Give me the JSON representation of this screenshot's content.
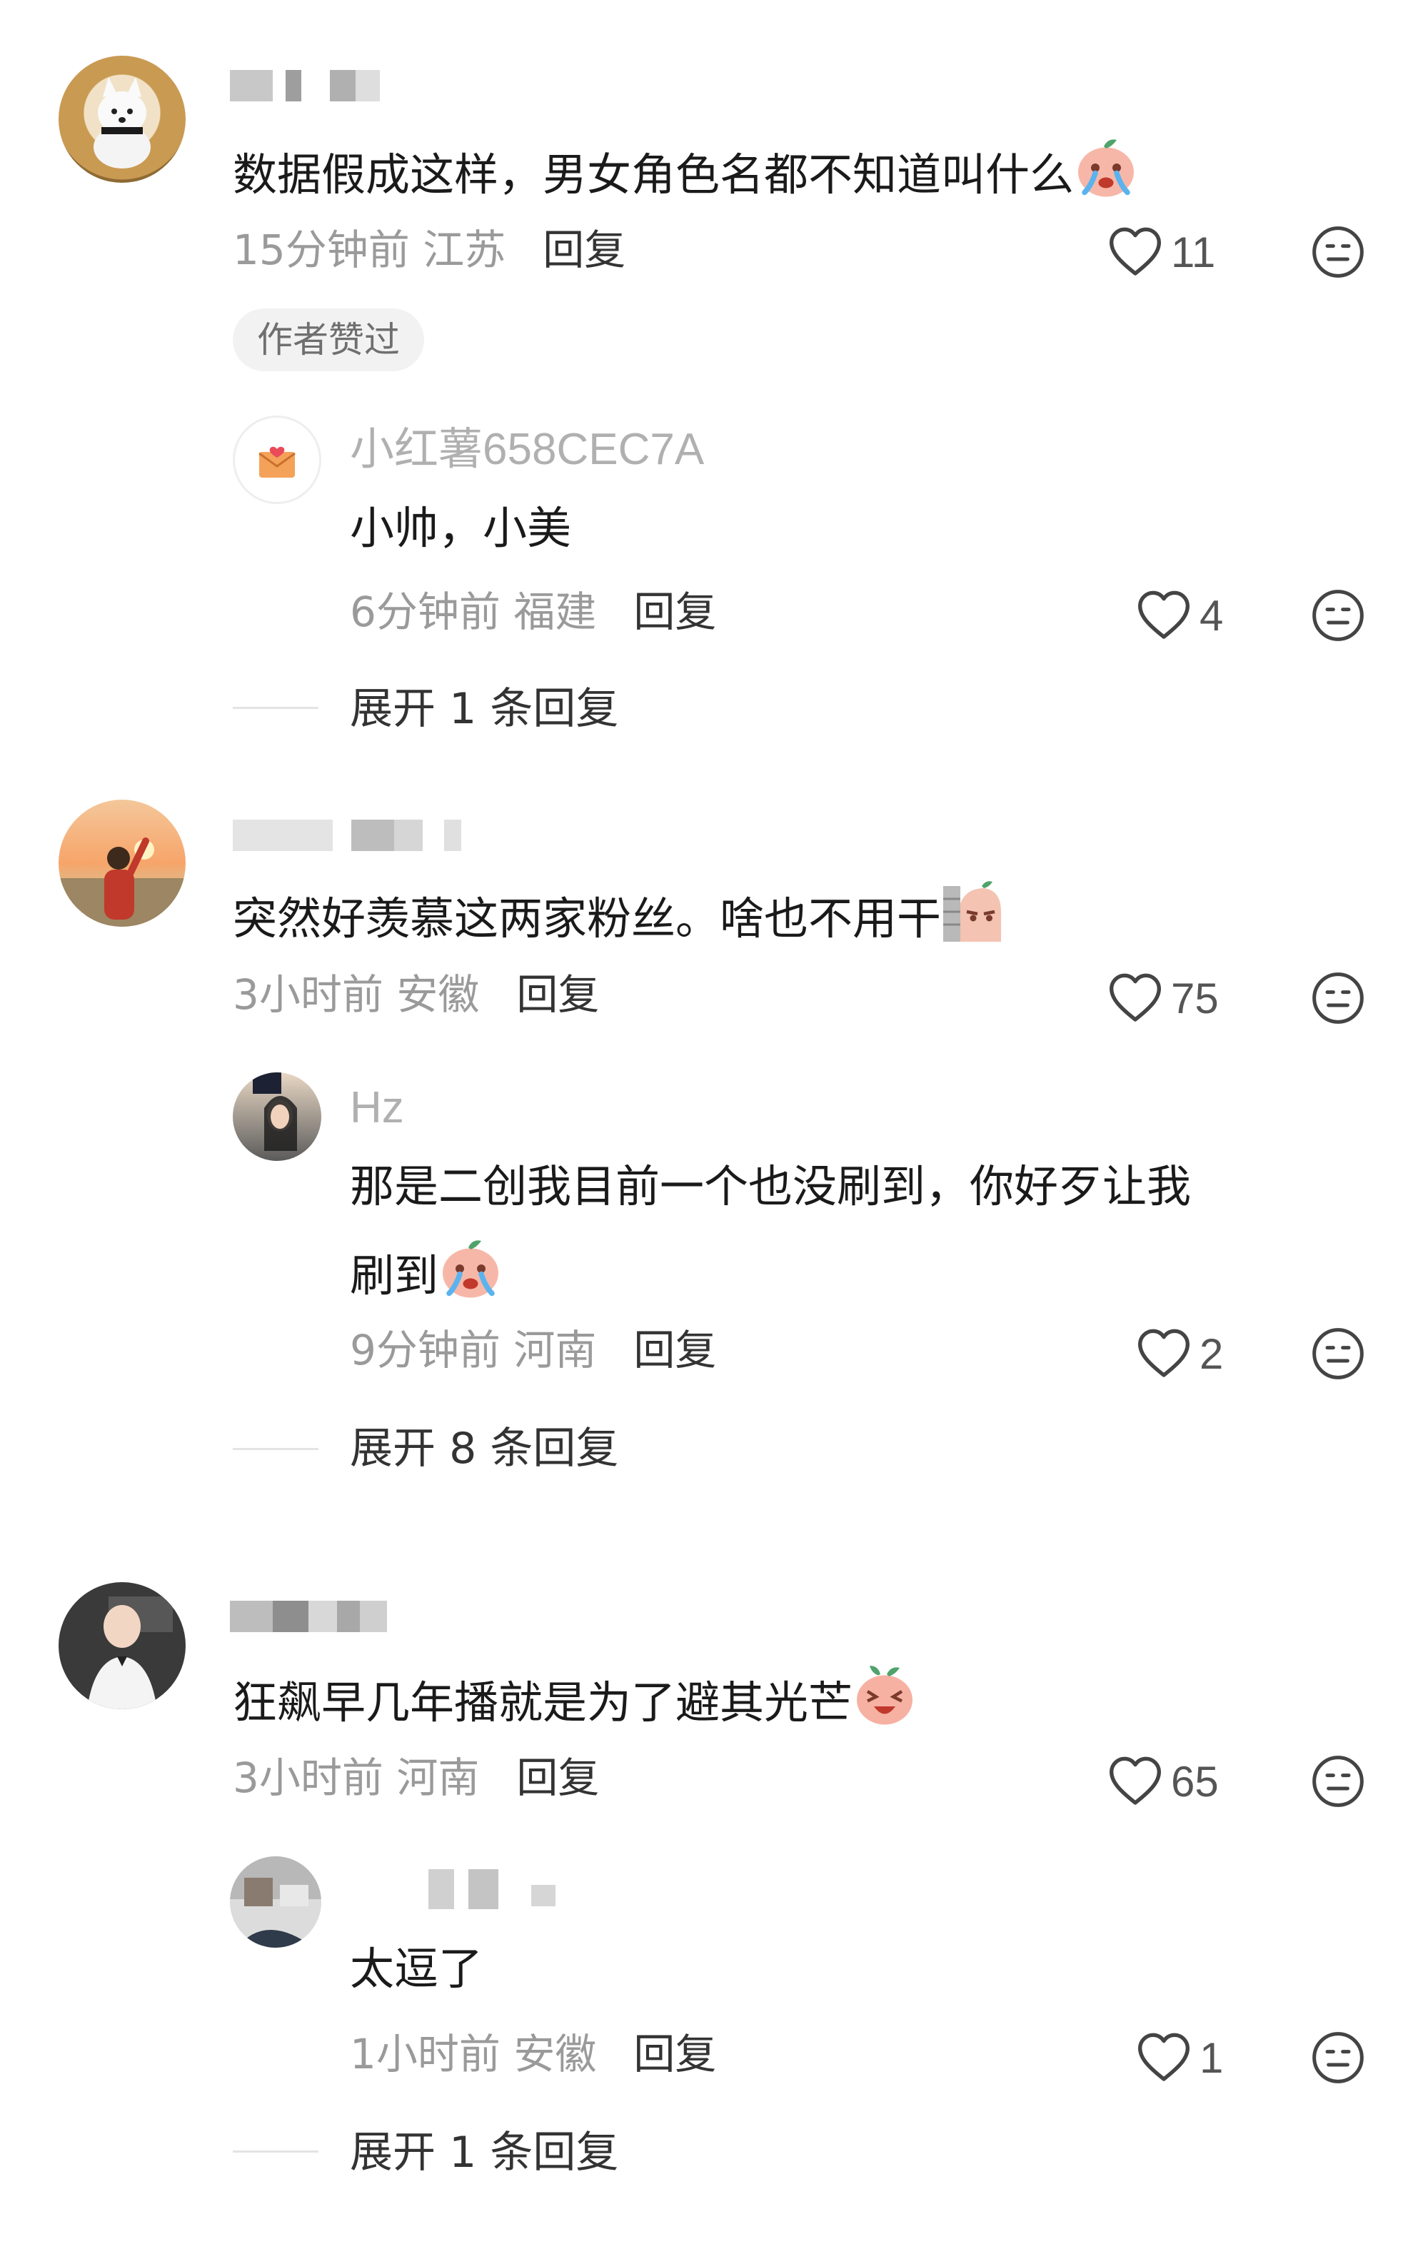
{
  "comments": [
    {
      "name": "",
      "text": "数据假成这样，男女角色名都不知道叫什么",
      "time_loc": "15分钟前 江苏",
      "reply_label": "回复",
      "likes": "11",
      "badge": "作者赞过",
      "replies": [
        {
          "name": "小红薯658CEC7A",
          "text": "小帅，小美",
          "time_loc": "6分钟前 福建",
          "reply_label": "回复",
          "likes": "4"
        }
      ],
      "expand": "展开 1 条回复"
    },
    {
      "name": "",
      "text": "突然好羡慕这两家粉丝。啥也不用干",
      "time_loc": "3小时前 安徽",
      "reply_label": "回复",
      "likes": "75",
      "replies": [
        {
          "name": "Hz",
          "text_line1": "那是二创我目前一个也没刷到，你好歹让我",
          "text_line2": "刷到",
          "time_loc": "9分钟前 河南",
          "reply_label": "回复",
          "likes": "2"
        }
      ],
      "expand": "展开 8 条回复"
    },
    {
      "name": "",
      "text": "狂飙早几年播就是为了避其光芒",
      "time_loc": "3小时前 河南",
      "reply_label": "回复",
      "likes": "65",
      "replies": [
        {
          "name": "",
          "text": "太逗了",
          "time_loc": "1小时前 安徽",
          "reply_label": "回复",
          "likes": "1"
        }
      ],
      "expand": "展开 1 条回复"
    }
  ],
  "icons": {
    "like": "heart-outline-icon",
    "more": "neutral-face-icon",
    "emoji_cry": "crying-potato-emoji-icon",
    "emoji_wall": "peeking-wall-emoji-icon",
    "emoji_laugh": "laughing-potato-emoji-icon"
  },
  "colors": {
    "meta": "#9a9a9a",
    "reply": "#333333",
    "badge_bg": "#f2f2f2"
  }
}
